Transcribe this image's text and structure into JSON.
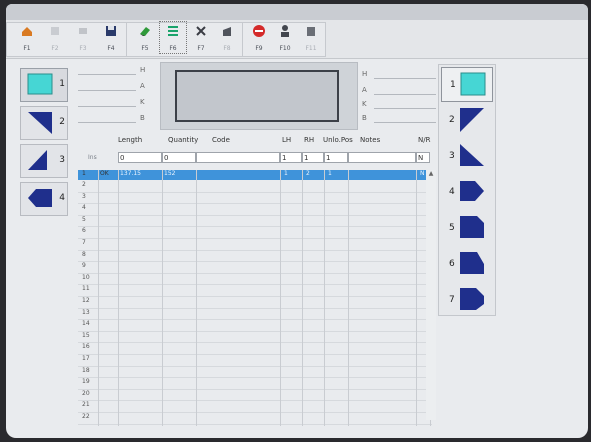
{
  "window": {
    "title": ""
  },
  "toolbar": {
    "items": [
      {
        "key": "F1",
        "icon": "home-icon"
      },
      {
        "key": "F2",
        "icon": "copy-icon"
      },
      {
        "key": "F3",
        "icon": "cut-icon"
      },
      {
        "key": "F4",
        "icon": "save-disk-icon"
      },
      {
        "key": "F5",
        "icon": "erase-icon"
      },
      {
        "key": "F6",
        "icon": "list-icon"
      },
      {
        "key": "F7",
        "icon": "tools-icon"
      },
      {
        "key": "F8",
        "icon": "hand-icon"
      },
      {
        "key": "F9",
        "icon": "stop-icon"
      },
      {
        "key": "F10",
        "icon": "operator-icon"
      },
      {
        "key": "F11",
        "icon": "machine-icon"
      }
    ]
  },
  "left_fields": {
    "labels": [
      "H",
      "A",
      "K",
      "B"
    ]
  },
  "right_fields": {
    "labels": [
      "H",
      "A",
      "K",
      "B"
    ]
  },
  "left_shapes": {
    "numbers": [
      "1",
      "2",
      "3",
      "4"
    ]
  },
  "right_shapes": {
    "numbers": [
      "1",
      "2",
      "3",
      "4",
      "5",
      "6",
      "7"
    ]
  },
  "grid": {
    "headers": {
      "length": "Length",
      "quantity": "Quantity",
      "code": "Code",
      "lh": "LH",
      "rh": "RH",
      "unlo_pos": "Unlo.Pos",
      "notes": "Notes",
      "nr": "N/R"
    },
    "ins_label": "Ins",
    "input_row": {
      "length": "0",
      "quantity": "0",
      "code": "",
      "lh": "1",
      "rh": "1",
      "unlo_pos": "1",
      "notes": "",
      "nr": "N"
    },
    "selected_row": {
      "num": "1",
      "status": "OK",
      "length": "137.15",
      "quantity": "152",
      "lh": "1",
      "rh": "2",
      "unlo_pos": "1",
      "nr": "N"
    },
    "row_numbers": [
      "2",
      "3",
      "4",
      "5",
      "6",
      "7",
      "8",
      "9",
      "10",
      "11",
      "12",
      "13",
      "14",
      "15",
      "16",
      "17",
      "18",
      "19",
      "20",
      "21",
      "22"
    ]
  },
  "colors": {
    "cyan": "#46d6d4",
    "navy": "#1f2f8c",
    "selection": "#3f93da"
  }
}
